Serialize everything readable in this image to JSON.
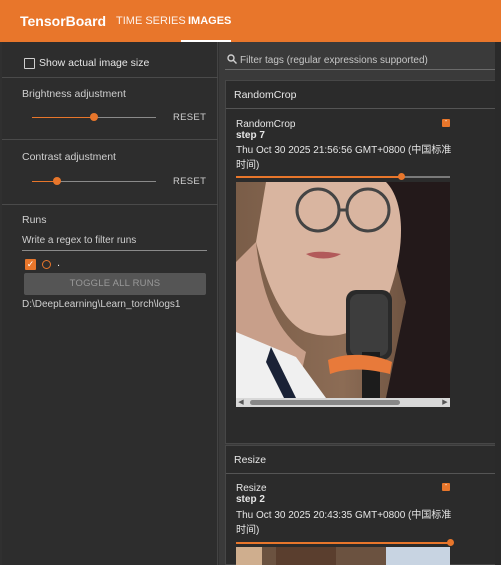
{
  "app": {
    "brand": "TensorBoard"
  },
  "tabs": [
    {
      "label": "TIME SERIES"
    },
    {
      "label": "IMAGES"
    }
  ],
  "sidebar": {
    "show_actual_size": "Show actual image size",
    "brightness": {
      "label": "Brightness adjustment",
      "reset": "RESET",
      "value_fraction": 0.5
    },
    "contrast": {
      "label": "Contrast adjustment",
      "reset": "RESET",
      "value_fraction": 0.2
    },
    "runs": {
      "label": "Runs",
      "filter_placeholder": "Write a regex to filter runs",
      "items": [
        {
          "label": "."
        }
      ],
      "toggle_all": "TOGGLE ALL RUNS",
      "path": "D:\\DeepLearning\\Learn_torch\\logs1"
    }
  },
  "main": {
    "filter_placeholder": "Filter tags (regular expressions supported)",
    "cards": [
      {
        "title": "RandomCrop",
        "tile": {
          "name": "RandomCrop",
          "step_label": "step",
          "step": "7",
          "timestamp": "Thu Oct 30 2025 21:56:56 GMT+0800 (中国标准时间)",
          "step_fraction": 0.77
        }
      },
      {
        "title": "Resize",
        "tile": {
          "name": "Resize",
          "step_label": "step",
          "step": "2",
          "timestamp": "Thu Oct 30 2025 20:43:35 GMT+0800 (中国标准时间)",
          "step_fraction": 1.0
        }
      }
    ]
  },
  "colors": {
    "accent": "#e8762b",
    "bg": "#303030",
    "panel": "#2b2b2b"
  }
}
